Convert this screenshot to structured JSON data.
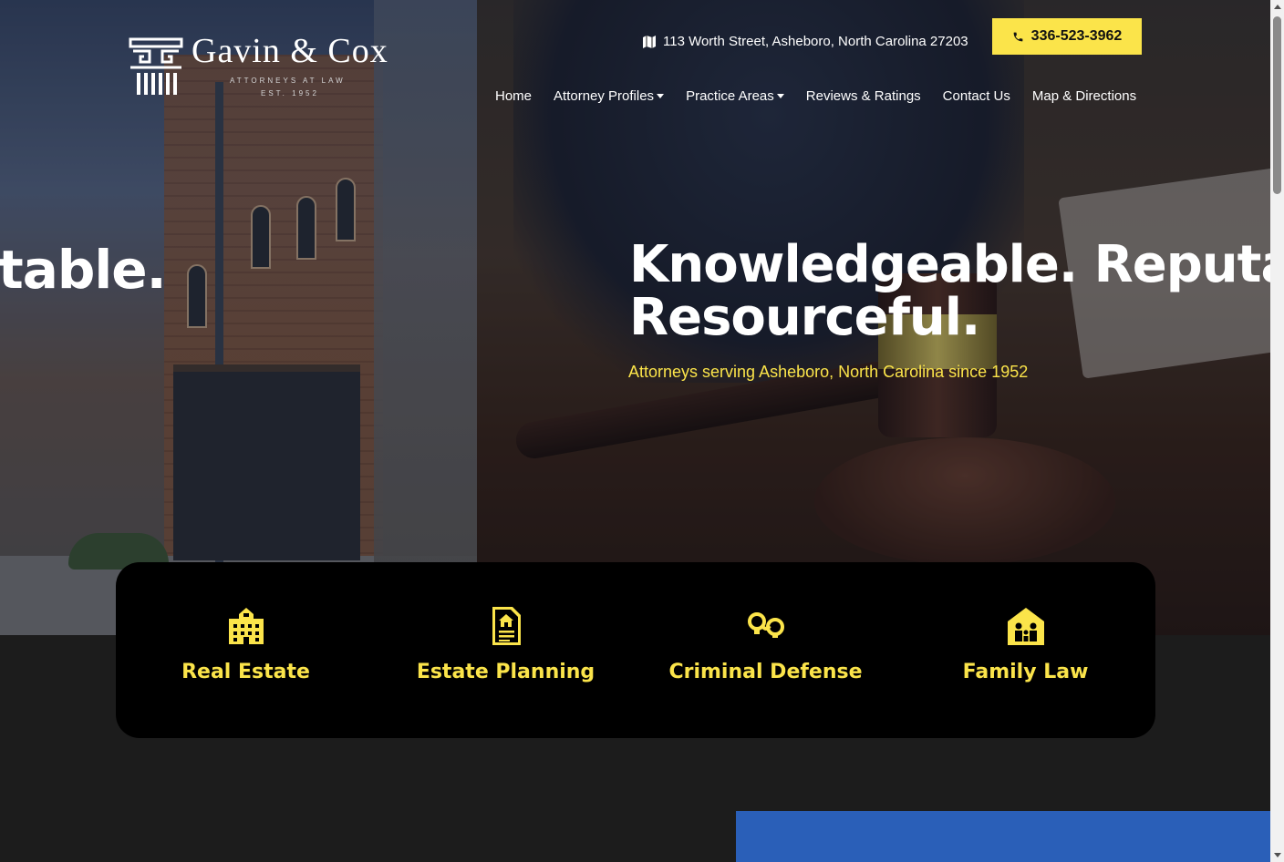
{
  "header": {
    "logo": {
      "name": "Gavin & Cox",
      "tagline": "ATTORNEYS AT LAW",
      "established": "EST. 1952"
    },
    "address": "113 Worth Street, Asheboro, North Carolina 27203",
    "address_icon": "map-icon",
    "phone": "336-523-3962",
    "phone_icon": "phone-icon"
  },
  "nav": {
    "items": [
      {
        "label": "Home",
        "dropdown": false
      },
      {
        "label": "Attorney Profiles",
        "dropdown": true
      },
      {
        "label": "Practice Areas",
        "dropdown": true
      },
      {
        "label": "Reviews & Ratings",
        "dropdown": false
      },
      {
        "label": "Contact Us",
        "dropdown": false
      },
      {
        "label": "Map & Directions",
        "dropdown": false
      }
    ]
  },
  "hero": {
    "previous_slide_text": "table.",
    "headline_line1": "Knowledgeable. Reputable.",
    "headline_line2": "Resourceful.",
    "subheadline": "Attorneys serving Asheboro, North Carolina since 1952"
  },
  "practice_areas": [
    {
      "label": "Real Estate",
      "icon": "building-icon"
    },
    {
      "label": "Estate Planning",
      "icon": "document-house-icon"
    },
    {
      "label": "Criminal Defense",
      "icon": "handcuffs-icon"
    },
    {
      "label": "Family Law",
      "icon": "family-home-icon"
    }
  ],
  "colors": {
    "accent": "#fbe44a",
    "card_bg": "#000000",
    "page_bg": "#1c1c1c",
    "blue_block": "#2a5fb8"
  }
}
